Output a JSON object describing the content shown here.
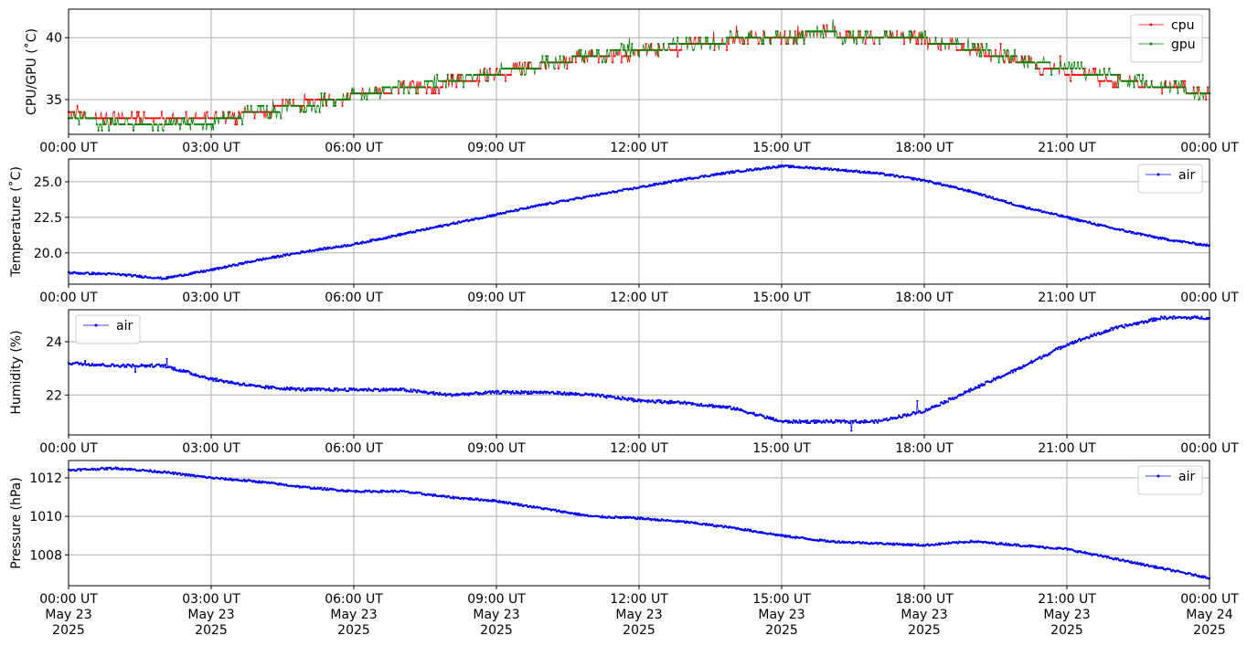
{
  "chart_data": [
    {
      "type": "line",
      "ylabel": "CPU/GPU (˚C)",
      "ylim": [
        32.2,
        42.3
      ],
      "yticks": [
        35,
        40
      ],
      "xrange": [
        "2025-05-23 00:00",
        "2025-05-24 00:00"
      ],
      "xticks": [
        "00:00 UT",
        "03:00 UT",
        "06:00 UT",
        "09:00 UT",
        "12:00 UT",
        "15:00 UT",
        "18:00 UT",
        "21:00 UT",
        "00:00 UT"
      ],
      "grid": true,
      "legend": "top-right",
      "series": [
        {
          "name": "cpu",
          "color": "#ff0000",
          "x": [
            "00:00",
            "01:00",
            "02:00",
            "03:00",
            "04:00",
            "05:00",
            "06:00",
            "07:00",
            "08:00",
            "09:00",
            "10:00",
            "11:00",
            "12:00",
            "13:00",
            "14:00",
            "15:00",
            "16:00",
            "17:00",
            "18:00",
            "19:00",
            "20:00",
            "21:00",
            "22:00",
            "23:00",
            "24:00"
          ],
          "values": [
            34.0,
            33.3,
            33.3,
            33.3,
            34.0,
            34.8,
            35.3,
            35.8,
            36.3,
            37.0,
            37.8,
            38.5,
            38.8,
            39.3,
            39.8,
            40.2,
            40.3,
            40.0,
            39.8,
            39.0,
            38.0,
            37.2,
            36.5,
            36.0,
            35.5
          ]
        },
        {
          "name": "gpu",
          "color": "#008000",
          "x": [
            "00:00",
            "01:00",
            "02:00",
            "03:00",
            "04:00",
            "05:00",
            "06:00",
            "07:00",
            "08:00",
            "09:00",
            "10:00",
            "11:00",
            "12:00",
            "13:00",
            "14:00",
            "15:00",
            "16:00",
            "17:00",
            "18:00",
            "19:00",
            "20:00",
            "21:00",
            "22:00",
            "23:00",
            "24:00"
          ],
          "values": [
            33.6,
            33.0,
            33.0,
            33.2,
            34.0,
            34.5,
            35.3,
            36.0,
            36.5,
            37.2,
            37.8,
            38.6,
            39.0,
            39.4,
            39.8,
            40.2,
            40.3,
            40.0,
            39.8,
            39.1,
            38.2,
            37.5,
            36.8,
            36.0,
            35.5
          ]
        }
      ]
    },
    {
      "type": "line",
      "ylabel": "Temperature (˚C)",
      "ylim": [
        17.8,
        26.6
      ],
      "yticks": [
        20.0,
        22.5,
        25.0
      ],
      "xticks": [
        "00:00 UT",
        "03:00 UT",
        "06:00 UT",
        "09:00 UT",
        "12:00 UT",
        "15:00 UT",
        "18:00 UT",
        "21:00 UT",
        "00:00 UT"
      ],
      "grid": true,
      "legend": "top-right",
      "series": [
        {
          "name": "air",
          "color": "#0000ff",
          "x": [
            "00:00",
            "01:00",
            "02:00",
            "03:00",
            "04:00",
            "05:00",
            "06:00",
            "07:00",
            "08:00",
            "09:00",
            "10:00",
            "11:00",
            "12:00",
            "13:00",
            "14:00",
            "15:00",
            "16:00",
            "17:00",
            "18:00",
            "19:00",
            "20:00",
            "21:00",
            "22:00",
            "23:00",
            "24:00"
          ],
          "values": [
            18.6,
            18.5,
            18.2,
            18.8,
            19.5,
            20.1,
            20.6,
            21.3,
            22.0,
            22.7,
            23.4,
            24.0,
            24.6,
            25.2,
            25.7,
            26.1,
            25.9,
            25.6,
            25.1,
            24.3,
            23.3,
            22.5,
            21.7,
            21.0,
            20.5
          ]
        }
      ]
    },
    {
      "type": "line",
      "ylabel": "Humidity (%)",
      "ylim": [
        20.5,
        25.2
      ],
      "yticks": [
        22,
        24
      ],
      "xticks": [
        "00:00 UT",
        "03:00 UT",
        "06:00 UT",
        "09:00 UT",
        "12:00 UT",
        "15:00 UT",
        "18:00 UT",
        "21:00 UT",
        "00:00 UT"
      ],
      "grid": true,
      "legend": "top-left",
      "series": [
        {
          "name": "air",
          "color": "#0000ff",
          "x": [
            "00:00",
            "01:00",
            "02:00",
            "03:00",
            "04:00",
            "05:00",
            "06:00",
            "07:00",
            "08:00",
            "09:00",
            "10:00",
            "11:00",
            "12:00",
            "13:00",
            "14:00",
            "15:00",
            "16:00",
            "17:00",
            "18:00",
            "19:00",
            "20:00",
            "21:00",
            "22:00",
            "23:00",
            "24:00"
          ],
          "values": [
            23.2,
            23.1,
            23.1,
            22.6,
            22.3,
            22.2,
            22.2,
            22.2,
            22.0,
            22.1,
            22.1,
            22.0,
            21.8,
            21.7,
            21.5,
            21.0,
            21.0,
            21.0,
            21.4,
            22.2,
            23.0,
            23.9,
            24.5,
            24.9,
            24.9
          ]
        }
      ]
    },
    {
      "type": "line",
      "ylabel": "Pressure (hPa)",
      "ylim": [
        1006.4,
        1012.9
      ],
      "yticks": [
        1008,
        1010,
        1012
      ],
      "xticks": [
        "00:00 UT\nMay 23\n2025",
        "03:00 UT\nMay 23\n2025",
        "06:00 UT\nMay 23\n2025",
        "09:00 UT\nMay 23\n2025",
        "12:00 UT\nMay 23\n2025",
        "15:00 UT\nMay 23\n2025",
        "18:00 UT\nMay 23\n2025",
        "21:00 UT\nMay 23\n2025",
        "00:00 UT\nMay 24\n2025"
      ],
      "grid": true,
      "legend": "top-right",
      "series": [
        {
          "name": "air",
          "color": "#0000ff",
          "x": [
            "00:00",
            "01:00",
            "02:00",
            "03:00",
            "04:00",
            "05:00",
            "06:00",
            "07:00",
            "08:00",
            "09:00",
            "10:00",
            "11:00",
            "12:00",
            "13:00",
            "14:00",
            "15:00",
            "16:00",
            "17:00",
            "18:00",
            "19:00",
            "20:00",
            "21:00",
            "22:00",
            "23:00",
            "24:00"
          ],
          "values": [
            1012.4,
            1012.5,
            1012.3,
            1012.0,
            1011.8,
            1011.5,
            1011.3,
            1011.3,
            1011.0,
            1010.8,
            1010.4,
            1010.0,
            1009.9,
            1009.7,
            1009.4,
            1009.0,
            1008.7,
            1008.6,
            1008.5,
            1008.7,
            1008.5,
            1008.3,
            1007.8,
            1007.3,
            1006.8
          ]
        }
      ]
    }
  ]
}
